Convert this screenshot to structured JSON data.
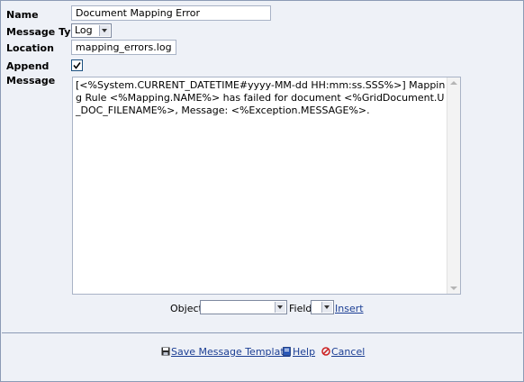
{
  "form": {
    "name_label": "Name",
    "name_value": "Document Mapping Error",
    "message_type_label": "Message Type",
    "message_type_value": "Log",
    "location_label": "Location",
    "location_value": "mapping_errors.log",
    "append_label": "Append",
    "append_checked": true,
    "message_label": "Message",
    "message_value": "[<%System.CURRENT_DATETIME#yyyy-MM-dd HH:mm:ss.SSS%>] Mapping Rule <%Mapping.NAME%> has failed for document <%GridDocument.U_DOC_FILENAME%>, Message: <%Exception.MESSAGE%>."
  },
  "insert_row": {
    "object_label": "Object",
    "object_value": "",
    "field_label": "Field",
    "field_value": "",
    "insert_link": "Insert"
  },
  "footer": {
    "save_label": "Save Message Template",
    "help_label": "Help",
    "cancel_label": "Cancel"
  },
  "icons": {
    "save": "save-disk-icon",
    "help": "help-book-icon",
    "cancel": "cancel-circle-icon",
    "check": "checkmark-icon"
  },
  "colors": {
    "background": "#eef1f7",
    "border": "#8c9bb5",
    "link": "#1c3f94",
    "cancel_icon": "#cc2222"
  }
}
